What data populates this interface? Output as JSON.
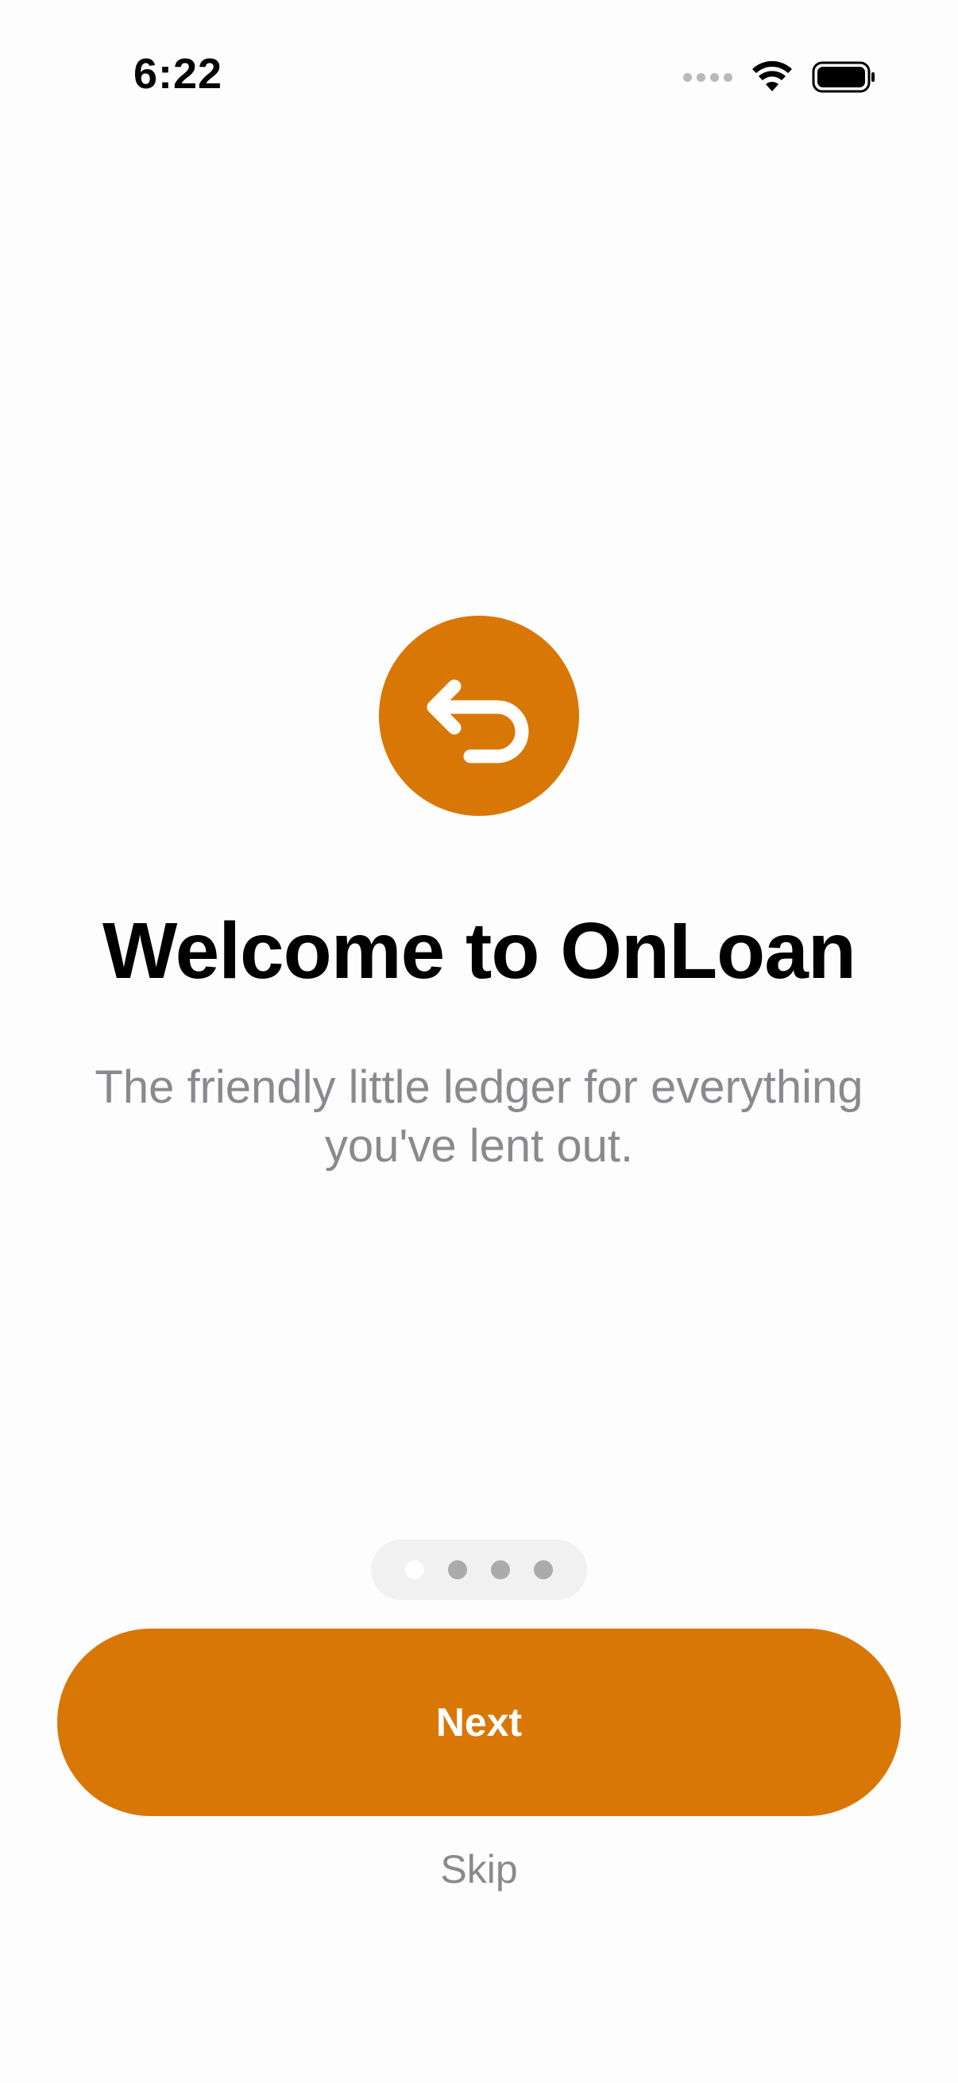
{
  "status_bar": {
    "time": "6:22",
    "icons": [
      "signal-dots-icon",
      "wifi-icon",
      "battery-icon"
    ]
  },
  "onboarding": {
    "logo_icon": "return-arrow-icon",
    "title": "Welcome to OnLoan",
    "subtitle": "The friendly little ledger for everything you've lent out.",
    "page_indicator": {
      "total_pages": 4,
      "current_page": 1
    },
    "next_label": "Next",
    "skip_label": "Skip"
  },
  "colors": {
    "accent": "#d97706",
    "background": "#fdfdfd",
    "secondary_text": "#8a8a8e",
    "title_text": "#000000"
  }
}
